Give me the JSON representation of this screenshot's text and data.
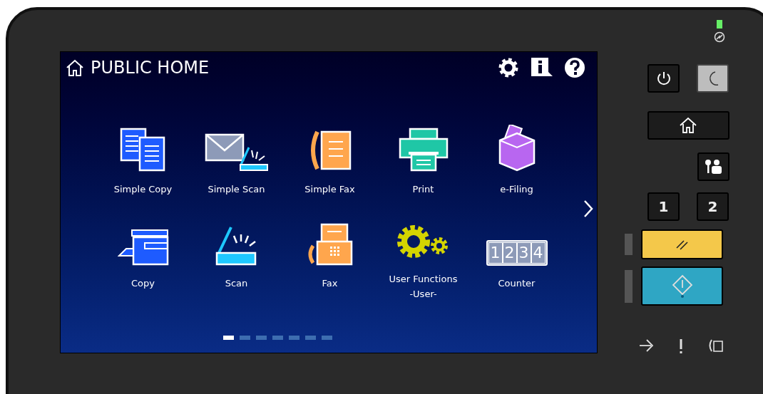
{
  "screen": {
    "title": "PUBLIC HOME",
    "apps": [
      {
        "label": "Simple Copy",
        "kind": "simple-copy"
      },
      {
        "label": "Simple Scan",
        "kind": "simple-scan"
      },
      {
        "label": "Simple Fax",
        "kind": "simple-fax"
      },
      {
        "label": "Print",
        "kind": "print"
      },
      {
        "label": "e-Filing",
        "kind": "efiling"
      },
      {
        "label": "Copy",
        "kind": "copy"
      },
      {
        "label": "Scan",
        "kind": "scan"
      },
      {
        "label": "Fax",
        "kind": "fax"
      },
      {
        "label": "User Functions\n-User-",
        "kind": "user-functions"
      },
      {
        "label": "Counter",
        "kind": "counter",
        "digits": [
          "1",
          "2",
          "3",
          "4"
        ]
      }
    ],
    "pages": [
      {
        "selected": true
      },
      {
        "selected": false
      },
      {
        "selected": false
      },
      {
        "selected": false
      },
      {
        "selected": false
      },
      {
        "selected": false
      },
      {
        "selected": false
      }
    ]
  },
  "panel": {
    "keys": [
      {
        "label": "1"
      },
      {
        "label": "2"
      }
    ]
  }
}
